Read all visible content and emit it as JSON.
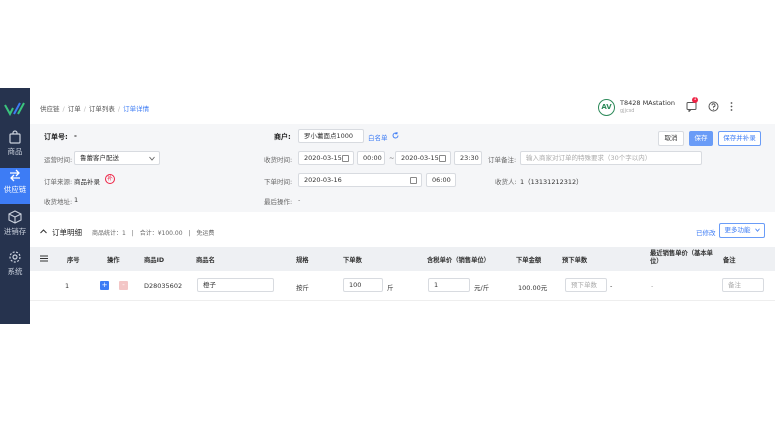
{
  "sidebar": {
    "items": [
      {
        "label": "商品"
      },
      {
        "label": "供应链"
      },
      {
        "label": "进销存"
      },
      {
        "label": "系统"
      }
    ]
  },
  "breadcrumb": {
    "items": [
      "供应链",
      "订单",
      "订单列表"
    ],
    "current": "订单详情"
  },
  "user": {
    "initials": "AV",
    "name": "T8428 MAstation",
    "sub": "gjjcsd",
    "notification_count": "1"
  },
  "order": {
    "order_no_label": "订单号:",
    "order_no_value": "-",
    "merchant_label": "商户:",
    "merchant_value": "罗小薯面点1000",
    "whitelist_label": "白名单",
    "delivery_time_label": "运营时间:",
    "delivery_time_value": "鲁蕾客户配送",
    "receive_time_label": "收货时间:",
    "receive_start_date": "2020-03-15",
    "receive_start_time": "00:00",
    "receive_sep": "~",
    "receive_end_date": "2020-03-15",
    "receive_end_time": "23:30",
    "remark_label": "订单备注:",
    "remark_placeholder": "输入商家对订单的特殊要求（30个字以内）",
    "source_label": "订单来源:",
    "source_value": "商品补录",
    "source_badge": "补",
    "order_time_label": "下单时间:",
    "order_date": "2020-03-16",
    "order_time": "06:00",
    "receiver_label": "收货人:",
    "receiver_value": "1（13131212312）",
    "address_label": "收货地址:",
    "address_value": "1",
    "last_op_label": "最后操作:",
    "last_op_value": "-"
  },
  "actions": {
    "cancel": "取消",
    "save": "保存",
    "save_add": "保存并补录"
  },
  "detail": {
    "title": "订单明细",
    "count_label": "商品统计：",
    "count_value": "1",
    "total_label": "合计：¥",
    "total_value": "100.00",
    "free_label": "免运费",
    "sep": "|",
    "batch_link": "已修改",
    "more_button": "更多功能"
  },
  "table": {
    "headers": [
      "序号",
      "操作",
      "商品ID",
      "商品名",
      "规格",
      "下单数",
      "含税单价（销售单位）",
      "下单金额",
      "预下单数",
      "最近销售单价（基本单位）",
      "备注"
    ],
    "row": {
      "index": "1",
      "product_id": "D28035602",
      "product_name": "橙子",
      "spec": "按斤",
      "qty": "100",
      "qty_unit": "斤",
      "price": "1",
      "price_unit": "元/斤",
      "amount": "100.00元",
      "pre_qty_placeholder": "预下单数",
      "pre_qty_dash": "-",
      "recent_price": "-",
      "remark_placeholder": "备注"
    }
  },
  "colors": {
    "sidebar": "#26334e",
    "accent": "#3d7cf5"
  }
}
